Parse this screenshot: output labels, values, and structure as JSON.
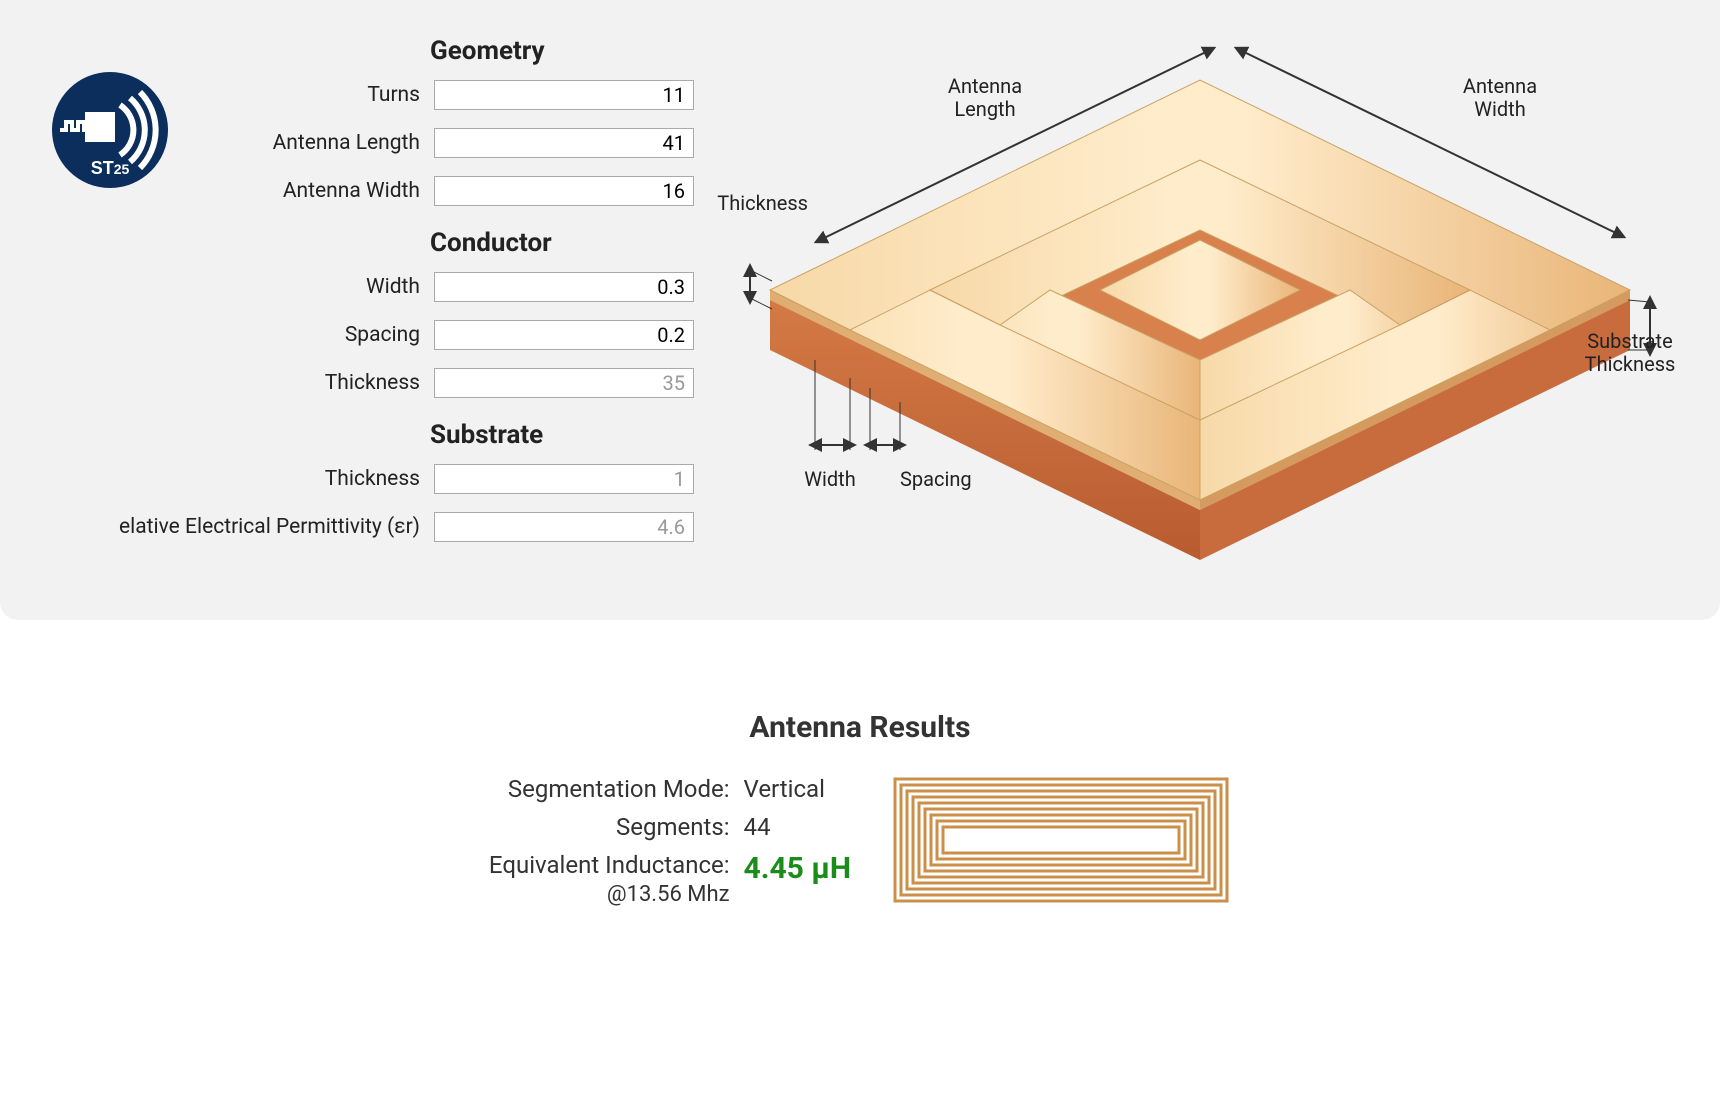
{
  "logo": {
    "label": "ST25"
  },
  "form": {
    "geometry": {
      "title": "Geometry",
      "turns": {
        "label": "Turns",
        "value": "11"
      },
      "length": {
        "label": "Antenna Length",
        "value": "41"
      },
      "width": {
        "label": "Antenna Width",
        "value": "16"
      }
    },
    "conductor": {
      "title": "Conductor",
      "width": {
        "label": "Width",
        "value": "0.3"
      },
      "spacing": {
        "label": "Spacing",
        "value": "0.2"
      },
      "thickness": {
        "label": "Thickness",
        "value": "35"
      }
    },
    "substrate": {
      "title": "Substrate",
      "thickness": {
        "label": "Thickness",
        "value": "1"
      },
      "er": {
        "label": "elative Electrical Permittivity (εr)",
        "value": "4.6"
      }
    }
  },
  "diagram": {
    "callouts": {
      "antenna_length": "Antenna\nLength",
      "antenna_width": "Antenna\nWidth",
      "thickness": "Thickness",
      "substrate_thickness": "Substrate\nThickness",
      "width": "Width",
      "spacing": "Spacing"
    }
  },
  "results": {
    "title": "Antenna Results",
    "seg_mode": {
      "label": "Segmentation Mode:",
      "value": "Vertical"
    },
    "segments": {
      "label": "Segments:",
      "value": "44"
    },
    "inductance": {
      "label": "Equivalent Inductance:",
      "value": "4.45 µH",
      "note": "@13.56 Mhz"
    }
  }
}
